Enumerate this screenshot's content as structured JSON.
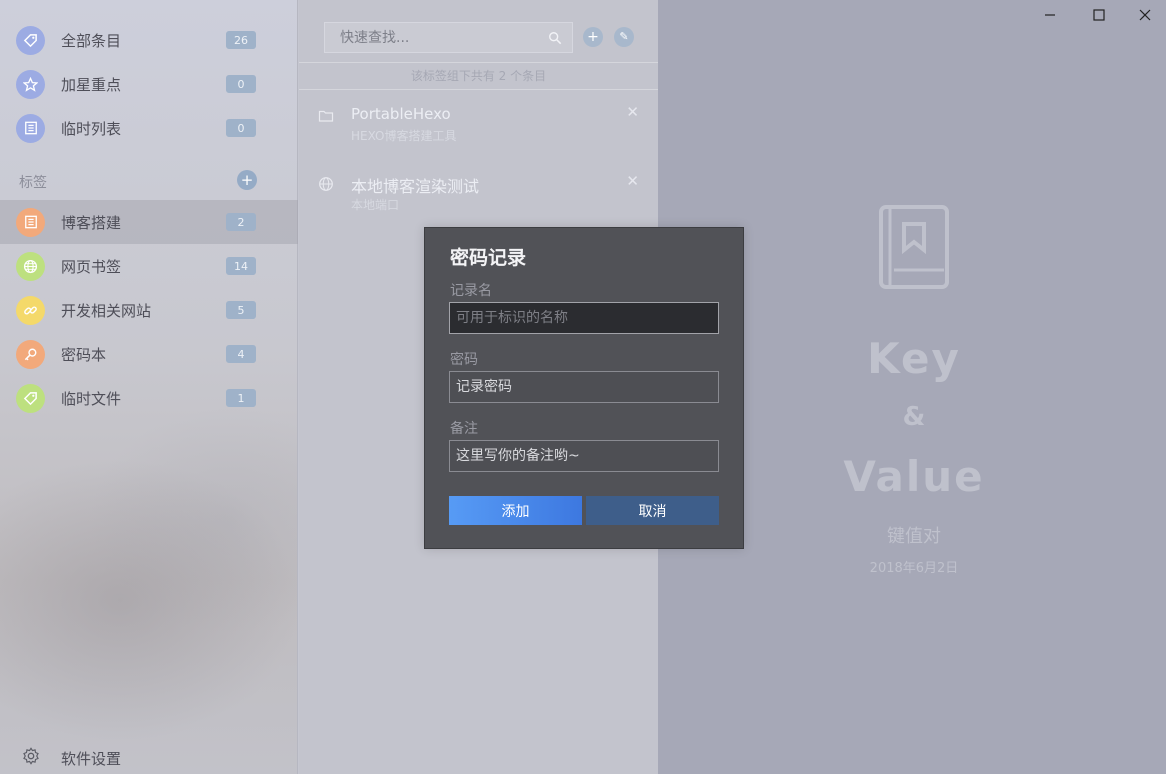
{
  "sidebar": {
    "main_items": [
      {
        "label": "全部条目",
        "count": "26",
        "icon": "tag-icon",
        "color": "#9cabe3"
      },
      {
        "label": "加星重点",
        "count": "0",
        "icon": "star-icon",
        "color": "#9cabe3"
      },
      {
        "label": "临时列表",
        "count": "0",
        "icon": "list-icon",
        "color": "#9cabe3"
      }
    ],
    "section_title": "标签",
    "add_tag_label": "+",
    "tags": [
      {
        "label": "博客搭建",
        "count": "2",
        "icon": "list-icon",
        "color": "#f2a97b"
      },
      {
        "label": "网页书签",
        "count": "14",
        "icon": "globe-icon",
        "color": "#bde07f"
      },
      {
        "label": "开发相关网站",
        "count": "5",
        "icon": "link-icon",
        "color": "#f4d96a"
      },
      {
        "label": "密码本",
        "count": "4",
        "icon": "key-icon",
        "color": "#f2a97b"
      },
      {
        "label": "临时文件",
        "count": "1",
        "icon": "tag-icon",
        "color": "#bde07f"
      }
    ],
    "settings_label": "软件设置"
  },
  "middle": {
    "search_placeholder": "快速查找...",
    "add_label": "+",
    "tool_label": "✎",
    "list_header": "该标签组下共有 2 个条目",
    "items": [
      {
        "title": "PortableHexo",
        "subtitle": "HEXO博客搭建工具",
        "icon": "folder-icon",
        "close": "✕"
      },
      {
        "title": "本地博客渲染测试",
        "subtitle": "本地端口",
        "icon": "globe-icon",
        "close": "✕"
      }
    ]
  },
  "brand": {
    "key": "Key",
    "amp": "&",
    "value": "Value",
    "subtitle": "键值对",
    "date": "2018年6月2日"
  },
  "dialog": {
    "title": "密码记录",
    "name_label": "记录名",
    "name_placeholder": "可用于标识的名称",
    "password_label": "密码",
    "password_placeholder": "记录密码",
    "note_label": "备注",
    "note_placeholder": "这里写你的备注哟~",
    "add_label": "添加",
    "cancel_label": "取消"
  }
}
